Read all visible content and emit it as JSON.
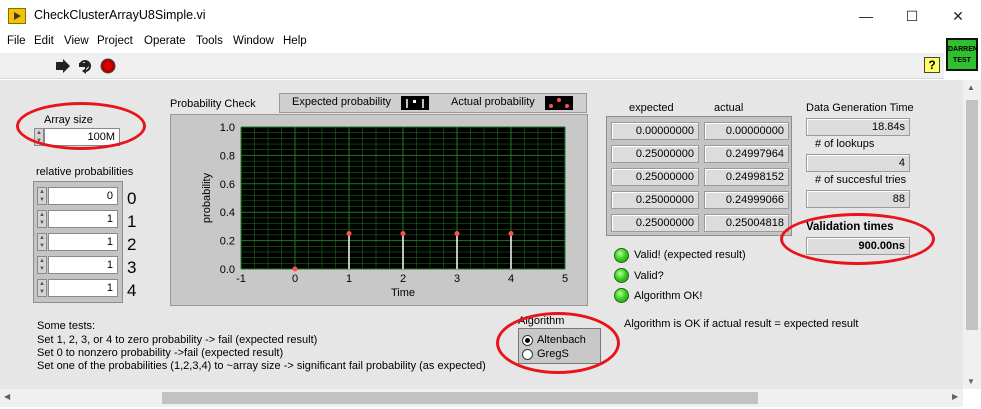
{
  "window": {
    "title": "CheckClusterArrayU8Simple.vi",
    "minimize": "—",
    "maximize": "☐",
    "close": "✕"
  },
  "menu": [
    "File",
    "Edit",
    "View",
    "Project",
    "Operate",
    "Tools",
    "Window",
    "Help"
  ],
  "toolbar": {
    "badge": "DARREN TEST",
    "help": "?"
  },
  "array_size": {
    "label": "Array size",
    "value": "100M"
  },
  "relative_probabilities": {
    "label": "relative probabilities",
    "rows": [
      {
        "value": "0",
        "index": "0"
      },
      {
        "value": "1",
        "index": "1"
      },
      {
        "value": "1",
        "index": "2"
      },
      {
        "value": "1",
        "index": "3"
      },
      {
        "value": "1",
        "index": "4"
      }
    ]
  },
  "graph": {
    "label": "Probability Check",
    "legend": [
      "Expected probability",
      "Actual probability"
    ]
  },
  "chart_data": {
    "type": "scatter",
    "xlabel": "Time",
    "ylabel": "probability",
    "xlim": [
      -1,
      5
    ],
    "ylim": [
      0,
      1
    ],
    "xticks": [
      "-1",
      "0",
      "1",
      "2",
      "3",
      "4",
      "5"
    ],
    "yticks": [
      "0.0",
      "0.2",
      "0.4",
      "0.6",
      "0.8",
      "1.0"
    ],
    "grid": true,
    "series": [
      {
        "name": "Expected probability",
        "x": [
          0,
          1,
          2,
          3,
          4
        ],
        "y": [
          0.0,
          0.25,
          0.25,
          0.25,
          0.25
        ],
        "color": "#ffffff"
      },
      {
        "name": "Actual probability",
        "x": [
          0,
          1,
          2,
          3,
          4
        ],
        "y": [
          0.0,
          0.24997964,
          0.24998152,
          0.24999066,
          0.25004818
        ],
        "color": "#ff5050"
      }
    ]
  },
  "results": {
    "expected_header": "expected",
    "actual_header": "actual",
    "expected": [
      "0.00000000",
      "0.25000000",
      "0.25000000",
      "0.25000000",
      "0.25000000"
    ],
    "actual": [
      "0.00000000",
      "0.24997964",
      "0.24998152",
      "0.24999066",
      "0.25004818"
    ]
  },
  "stats": {
    "gen_time_label": "Data Generation Time",
    "gen_time_value": "18.84s",
    "lookups_label": "# of lookups",
    "lookups_value": "4",
    "tries_label": "# of succesful tries",
    "tries_value": "88",
    "validation_label": "Validation times",
    "validation_value": "900.00ns"
  },
  "leds": [
    "Valid! (expected result)",
    "Valid?",
    "Algorithm OK!"
  ],
  "algorithm": {
    "label": "Algorithm",
    "options": [
      "Altenbach",
      "GregS"
    ],
    "selected": "Altenbach"
  },
  "notes": {
    "algo_ok": "Algorithm is OK if actual result = expected result",
    "tests": [
      "Some tests:",
      "Set 1, 2, 3, or 4 to zero probability -> fail (expected result)",
      "Set 0 to nonzero probability ->fail (expected result)",
      "Set one of the probabilities (1,2,3,4) to ~array size -> significant fail probability (as expected)"
    ]
  },
  "colors": {
    "plot_bg": "#000000",
    "grid": "#1e7a1e",
    "highlight": "#e8141a",
    "led": "#3fcf25"
  }
}
